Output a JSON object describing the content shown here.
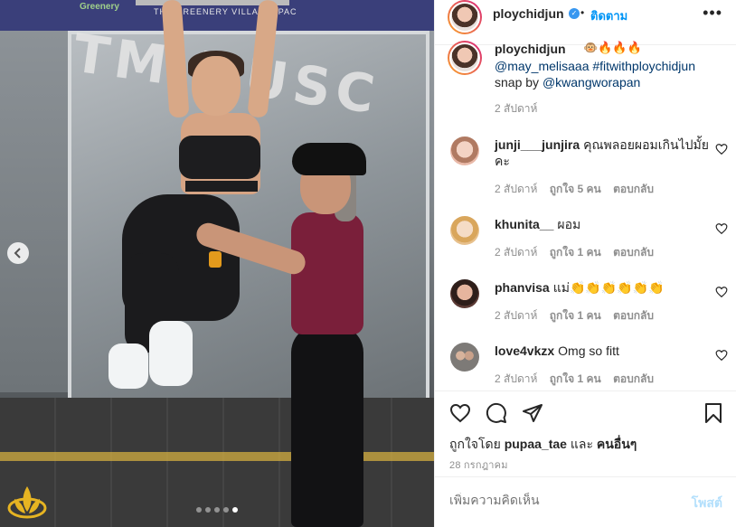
{
  "photo": {
    "sponsor_text": "Greenery",
    "banner_text": "THE GREENERY VILLA ON PAC",
    "gym_sign": "TM.HUSC",
    "prev_icon": "chevron-left-icon",
    "carousel": {
      "count": 5,
      "active_index": 4
    }
  },
  "header": {
    "username": "ploychidjun",
    "separator": "•",
    "follow_label": "ติดตาม",
    "more_icon": "more-horizontal-icon"
  },
  "caption": {
    "username": "ploychidjun",
    "emoji": "🐵🔥🔥🔥",
    "line1": "@may_melisaaa #fitwithploychidjun",
    "line2_prefix": "snap by",
    "line2_link": "@kwangworapan",
    "time": "2 สัปดาห์"
  },
  "comments": [
    {
      "username": "junji___junjira",
      "text": "คุณพลอยผอมเกินไปมั้ยคะ",
      "time": "2 สัปดาห์",
      "likes": "ถูกใจ 5 คน",
      "reply": "ตอบกลับ",
      "avatar_color": "#e9b9a8"
    },
    {
      "username": "khunita__",
      "text": "ผอม",
      "time": "2 สัปดาห์",
      "likes": "ถูกใจ 1 คน",
      "reply": "ตอบกลับ",
      "avatar_color": "#e7c08c"
    },
    {
      "username": "phanvisa",
      "text": "แม่👏👏👏👏👏👏",
      "time": "2 สัปดาห์",
      "likes": "ถูกใจ 1 คน",
      "reply": "ตอบกลับ",
      "avatar_color": "#5b3a34"
    },
    {
      "username": "love4vkzx",
      "text": "Omg so fitt",
      "time": "2 สัปดาห์",
      "likes": "ถูกใจ 1 คน",
      "reply": "ตอบกลับ",
      "avatar_color": "#8d8a86"
    }
  ],
  "actions": {
    "like_icon": "heart-icon",
    "comment_icon": "comment-icon",
    "share_icon": "share-icon",
    "save_icon": "bookmark-icon",
    "likes_prefix": "ถูกใจโดย",
    "likes_user": "pupaa_tae",
    "likes_and": "และ",
    "likes_others": "คนอื่นๆ",
    "date": "28 กรกฎาคม"
  },
  "add_comment": {
    "placeholder": "เพิ่มความคิดเห็น",
    "post_label": "โพสต์"
  },
  "colors": {
    "link": "#00376b",
    "follow": "#0095f6",
    "verified": "#3897f0",
    "muted": "#8e8e8e",
    "post_disabled": "#b2dffc"
  }
}
